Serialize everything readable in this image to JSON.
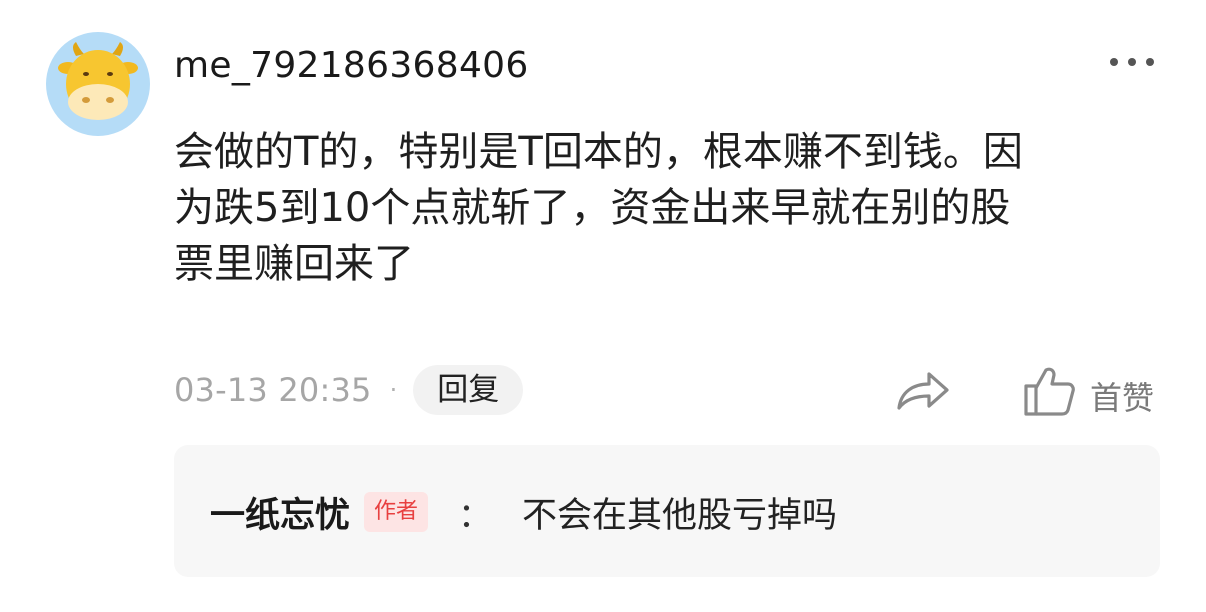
{
  "comment": {
    "username": "me_792186368406",
    "avatar_icon": "cow-icon",
    "avatar_bg_color": "#b5dcf7",
    "more_icon": "more-dots-icon",
    "content": "会做的T的，特别是T回本的，根本赚不到钱。因\n为跌5到10个点就斩了，资金出来早就在别的股\n票里赚回来了",
    "timestamp": "03-13 20:35",
    "separator": "·",
    "reply_label": "回复",
    "share_icon": "share-arrow-icon",
    "like_icon": "thumbs-up-icon",
    "like_label": "首赞"
  },
  "replies": [
    {
      "author": "一纸忘忧",
      "badge": "作者",
      "badge_color": "#e84040",
      "colon": "：",
      "text": "不会在其他股亏掉吗"
    }
  ]
}
